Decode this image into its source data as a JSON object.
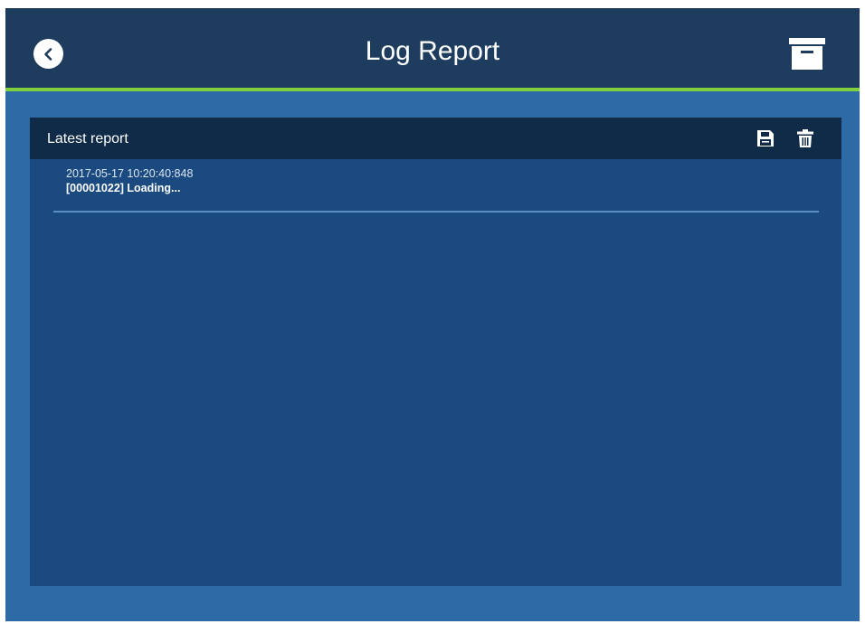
{
  "header": {
    "title": "Log Report",
    "colors": {
      "bar": "#1e3c5d",
      "accent": "#7fd03f"
    },
    "back_icon": "chevron-left-icon",
    "archive_icon": "archive-box-icon"
  },
  "panel": {
    "title": "Latest report",
    "save_icon": "floppy-disk-icon",
    "delete_icon": "trash-icon",
    "entries": [
      {
        "timestamp": "2017-05-17 10:20:40:848",
        "message": "[00001022] Loading..."
      }
    ]
  }
}
